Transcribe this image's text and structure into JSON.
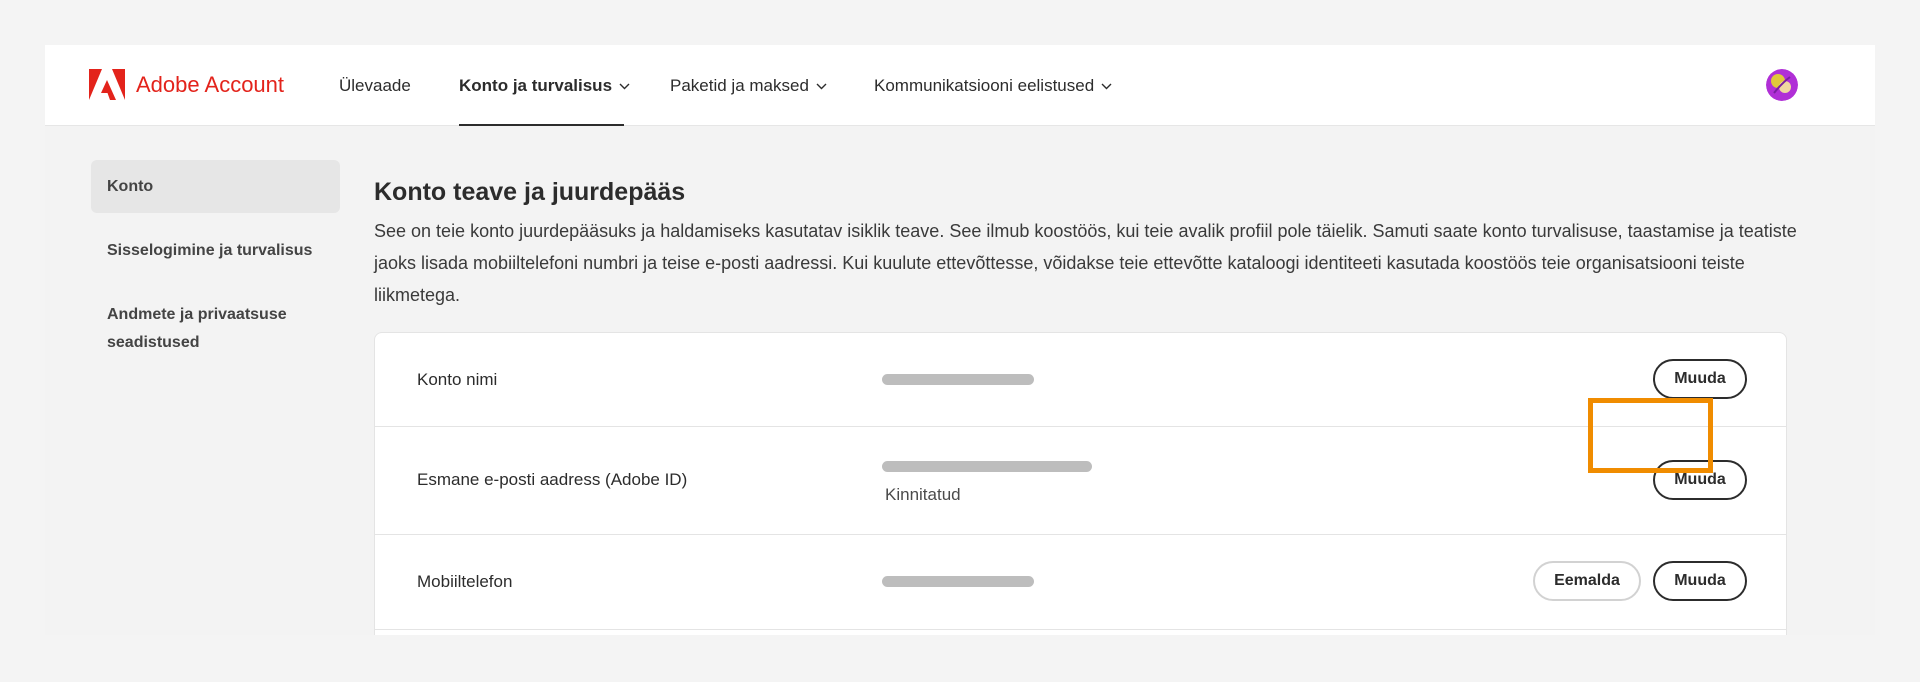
{
  "header": {
    "brand": "Adobe Account",
    "nav": [
      {
        "label": "Ülevaade"
      },
      {
        "label": "Konto ja turvalisus"
      },
      {
        "label": "Paketid ja maksed"
      },
      {
        "label": "Kommunikatsiooni eelistused"
      }
    ]
  },
  "sidebar": {
    "items": [
      {
        "label": "Konto"
      },
      {
        "label": "Sisselogimine ja turvalisus"
      },
      {
        "label": "Andmete ja privaatsuse seadistused"
      }
    ]
  },
  "main": {
    "title": "Konto teave ja juurdepääs",
    "description": "See on teie konto juurdepääsuks ja haldamiseks kasutatav isiklik teave. See ilmub koostöös, kui teie avalik profiil pole täielik. Samuti saate konto turvalisuse, taastamise ja teatiste jaoks lisada mobiiltelefoni numbri ja teise e-posti aadressi. Kui kuulute ettevõttesse, võidakse teie ettevõtte kataloogi identiteeti kasutada koostöös teie organisatsiooni teiste liikmetega.",
    "rows": [
      {
        "label": "Konto nimi",
        "button": "Muuda"
      },
      {
        "label": "Esmane e-posti aadress (Adobe ID)",
        "status": "Kinnitatud",
        "button": "Muuda"
      },
      {
        "label": "Mobiiltelefon",
        "secondary_button": "Eemalda",
        "button": "Muuda"
      }
    ]
  },
  "colors": {
    "brand": "#e3231b",
    "highlight": "#f08c00"
  }
}
